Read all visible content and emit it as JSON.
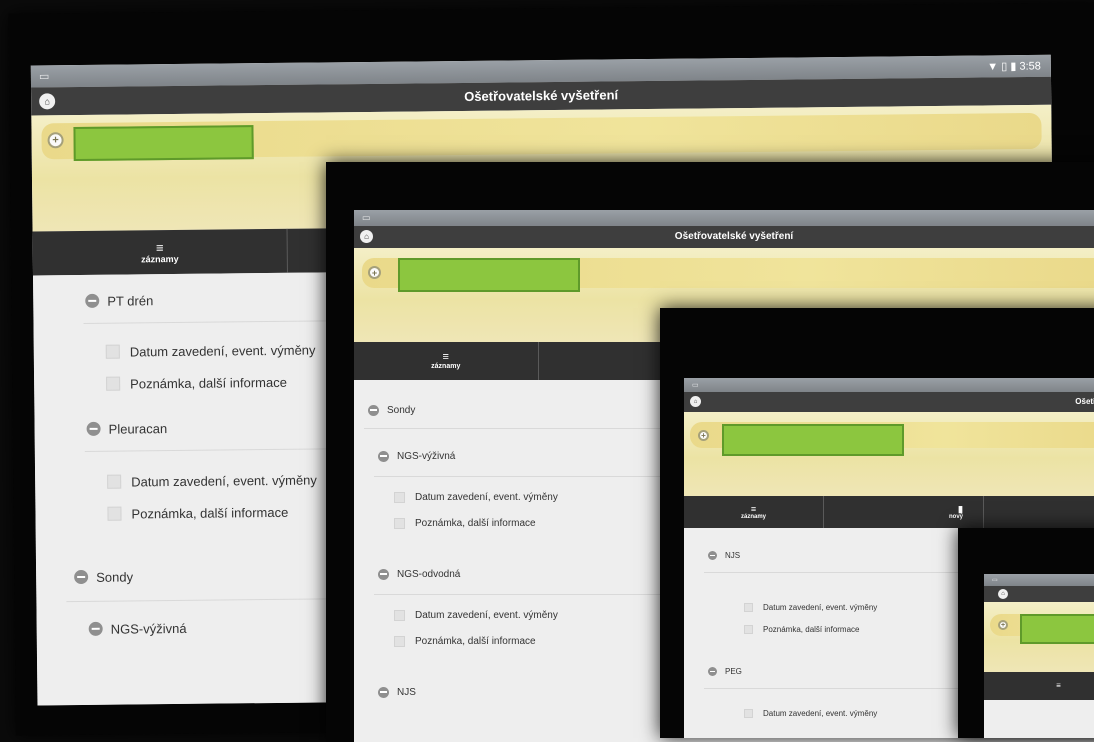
{
  "status": {
    "time": "3:58",
    "icons": "▼ ▯ ▮"
  },
  "app": {
    "title": "Ošetřovatelské vyšetření"
  },
  "tabs": {
    "records": "záznamy",
    "new": "nový"
  },
  "icons": {
    "home": "home-icon",
    "add": "plus-circle-icon",
    "list": "list-icon",
    "new": "document-icon",
    "section": "minus-circle-icon"
  },
  "fields": {
    "inserted": "Datum zavedení, event. výměny",
    "note": "Poznámka, další informace"
  },
  "sections": {
    "pt_dren": "PT drén",
    "pleuracan": "Pleuracan",
    "sondy": "Sondy",
    "ngs_vyzivna": "NGS-výživná",
    "ngs_odvodna": "NGS-odvodná",
    "njs": "NJS",
    "peg": "PEG"
  },
  "colors": {
    "redaction": "#8cc63f",
    "titlebar": "#3e3e3e",
    "patient_bg": "#ece3a4"
  }
}
